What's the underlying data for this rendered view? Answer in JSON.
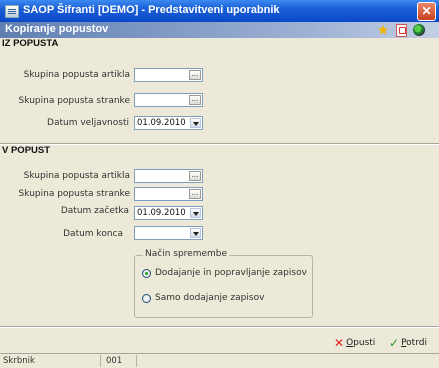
{
  "window": {
    "title": "SAOP Šifranti [DEMO] - Predstavitveni uporabnik",
    "close_label": "✕"
  },
  "header": {
    "title": "Kopiranje popustov",
    "icons": [
      "star-icon",
      "document-icon",
      "globe-icon"
    ]
  },
  "from_section": {
    "title": "IZ POPUSTA",
    "article_group_label": "Skupina popusta artikla",
    "article_group_value": "",
    "customer_group_label": "Skupina popusta stranke",
    "customer_group_value": "",
    "valid_date_label": "Datum veljavnosti",
    "valid_date_value": "01.09.2010"
  },
  "to_section": {
    "title": "V POPUST",
    "article_group_label": "Skupina popusta artikla",
    "article_group_value": "",
    "customer_group_label": "Skupina popusta stranke",
    "customer_group_value": "",
    "start_date_label": "Datum začetka",
    "start_date_value": "01.09.2010",
    "end_date_label": "Datum konca",
    "end_date_value": ""
  },
  "change_mode": {
    "title": "Način spremembe",
    "options": [
      {
        "label": "Dodajanje in popravljanje zapisov",
        "selected": true
      },
      {
        "label": "Samo dodajanje zapisov",
        "selected": false
      }
    ]
  },
  "actions": {
    "cancel_label": "Opusti",
    "confirm_label": "Potrdi"
  },
  "statusbar": {
    "label": "Skrbnik",
    "value": "001"
  },
  "colors": {
    "title_bar": "#0a49c8",
    "header_bar": "#5f7fb2",
    "background": "#ece9d8"
  }
}
